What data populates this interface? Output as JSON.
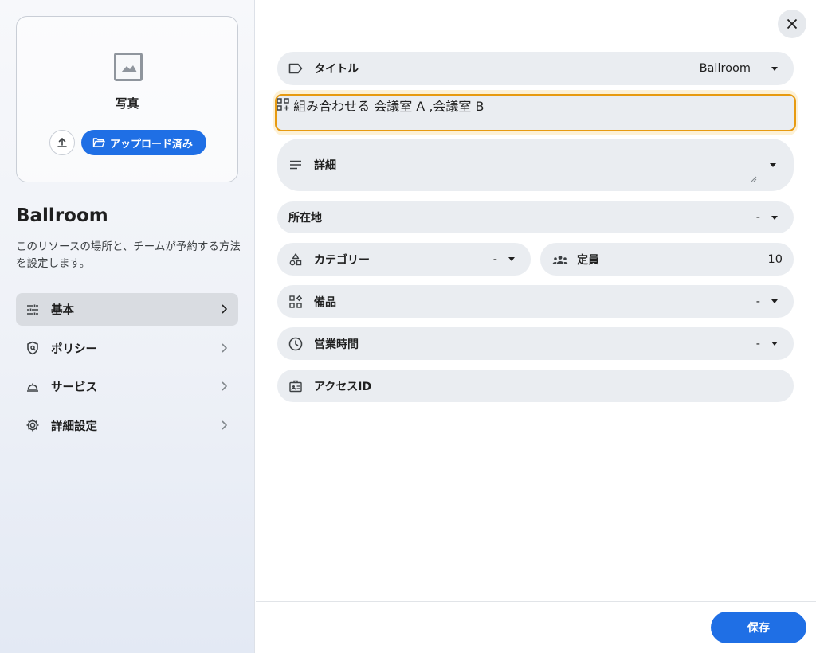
{
  "sidebar": {
    "photo_label": "写真",
    "uploaded_label": "アップロード済み",
    "resource_name": "Ballroom",
    "description": "このリソースの場所と、チームが予約する方法を設定します。",
    "nav": [
      {
        "label": "基本",
        "icon": "tune-icon",
        "active": true
      },
      {
        "label": "ポリシー",
        "icon": "policy-shield-icon",
        "active": false
      },
      {
        "label": "サービス",
        "icon": "room-service-icon",
        "active": false
      },
      {
        "label": "詳細設定",
        "icon": "gear-icon",
        "active": false
      }
    ]
  },
  "form": {
    "title": {
      "label": "タイトル",
      "value": "Ballroom"
    },
    "combine": {
      "label": "組み合わせる",
      "value": "会議室 A ,会議室 B"
    },
    "details": {
      "label": "詳細"
    },
    "location": {
      "label": "所在地",
      "value": "-"
    },
    "category": {
      "label": "カテゴリー",
      "value": "-"
    },
    "capacity": {
      "label": "定員",
      "value": "10"
    },
    "equipment": {
      "label": "備品",
      "value": "-"
    },
    "hours": {
      "label": "営業時間",
      "value": "-"
    },
    "access_id": {
      "label": "アクセスID"
    }
  },
  "footer": {
    "save_label": "保存"
  },
  "colors": {
    "accent": "#1f6fe5",
    "highlight": "#e79a10",
    "field_bg": "#eaedf1"
  }
}
